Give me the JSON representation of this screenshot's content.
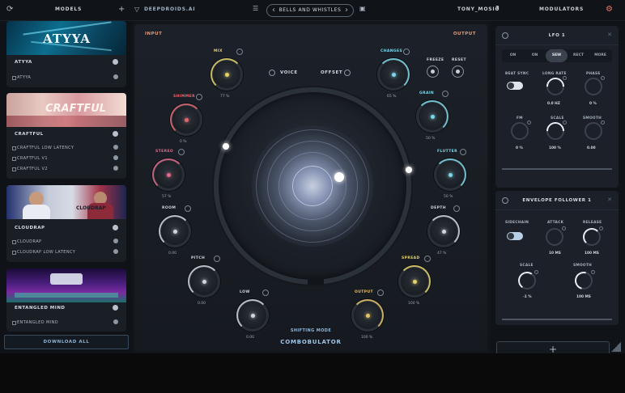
{
  "topbar": {
    "models_title": "MODELS",
    "add_symbol": "+",
    "brand_name": "DEEPDROIDS.AI",
    "preset_name": "BELLS AND WHISTLES",
    "prev_arrow": "‹",
    "next_arrow": "›",
    "user_name": "TONY_MOSIO",
    "help_symbol": "?",
    "modulators_title": "MODULATORS"
  },
  "models": [
    {
      "banner_text": "ATYYA",
      "title": "ATYYA",
      "items": [
        "ATYYA"
      ],
      "banner_colors": [
        "#0d5e7a",
        "#1a8fb0",
        "#e7f3ff"
      ]
    },
    {
      "banner_text": "CRAFTFUL",
      "title": "CRAFTFUL",
      "items": [
        "CRAFTFUL LOW LATENCY",
        "CRAFTFUL V1",
        "CRAFTFUL V2"
      ],
      "banner_colors": [
        "#d98f8f",
        "#f0c9c0",
        "#7d2f3b"
      ]
    },
    {
      "banner_text": "CLOUDRAP",
      "title": "CLOUDRAP",
      "items": [
        "CLOUDRAP",
        "CLOUDRAP LOW LATENCY"
      ],
      "banner_colors": [
        "#1f2a60",
        "#d8dde8",
        "#b8334d"
      ]
    },
    {
      "banner_text": "",
      "title": "ENTANGLED MIND",
      "items": [
        "ENTANGLED MIND"
      ],
      "banner_colors": [
        "#2a1550",
        "#6a2b96",
        "#3fd0a8"
      ]
    }
  ],
  "download_all": "DOWNLOAD ALL",
  "main": {
    "input_label": "INPUT",
    "output_label": "OUTPUT",
    "voice_label": "VOICE",
    "offset_label": "OFFSET",
    "freeze_label": "FREEZE",
    "reset_label": "RESET",
    "shifting_mode": "SHIFTING MODE",
    "product_name": "COMBOBULATOR",
    "knobs": [
      {
        "label": "MIX",
        "value": "77 %",
        "color": "#e4d36a"
      },
      {
        "label": "SHIMMER",
        "value": "0 %",
        "color": "#e06a72"
      },
      {
        "label": "STEREO",
        "value": "57 %",
        "color": "#e06a8a"
      },
      {
        "label": "ROOM",
        "value": "0.00",
        "color": "#cfd6de"
      },
      {
        "label": "PITCH",
        "value": "0.00",
        "color": "#cfd6de"
      },
      {
        "label": "LOW",
        "value": "0.00",
        "color": "#cfd6de"
      },
      {
        "label": "CHANGES",
        "value": "65 %",
        "color": "#7ed7e6"
      },
      {
        "label": "GRAIN",
        "value": "50 %",
        "color": "#7ed7e6"
      },
      {
        "label": "FLUTTER",
        "value": "50 %",
        "color": "#7ed7e6"
      },
      {
        "label": "DEPTH",
        "value": "47 %",
        "color": "#cfd6de"
      },
      {
        "label": "SPREAD",
        "value": "100 %",
        "color": "#e4d36a"
      },
      {
        "label": "OUTPUT",
        "value": "100 %",
        "color": "#e4c36a"
      }
    ]
  },
  "modulators": {
    "lfo": {
      "title": "LFO 1",
      "modes": [
        "ON",
        "ON",
        "SEW",
        "RECT",
        "MORE"
      ],
      "selected_mode": "SEW",
      "controls": [
        {
          "label": "BEAT SYNC",
          "value": ""
        },
        {
          "label": "LONG RATE",
          "value": "0.0 HZ"
        },
        {
          "label": "PHASE",
          "value": "0 %"
        },
        {
          "label": "FM",
          "value": "0 %"
        },
        {
          "label": "SCALE",
          "value": "100 %"
        },
        {
          "label": "SMOOTH",
          "value": "0.00"
        }
      ]
    },
    "envelope": {
      "title": "ENVELOPE FOLLOWER 1",
      "controls": [
        {
          "label": "SIDECHAIN",
          "value": ""
        },
        {
          "label": "ATTACK",
          "value": "10 MS"
        },
        {
          "label": "RELEASE",
          "value": "100 MS"
        },
        {
          "label": "SCALE",
          "value": "-1 %"
        },
        {
          "label": "SMOOTH",
          "value": "100 MS"
        }
      ]
    },
    "add_symbol": "+"
  }
}
